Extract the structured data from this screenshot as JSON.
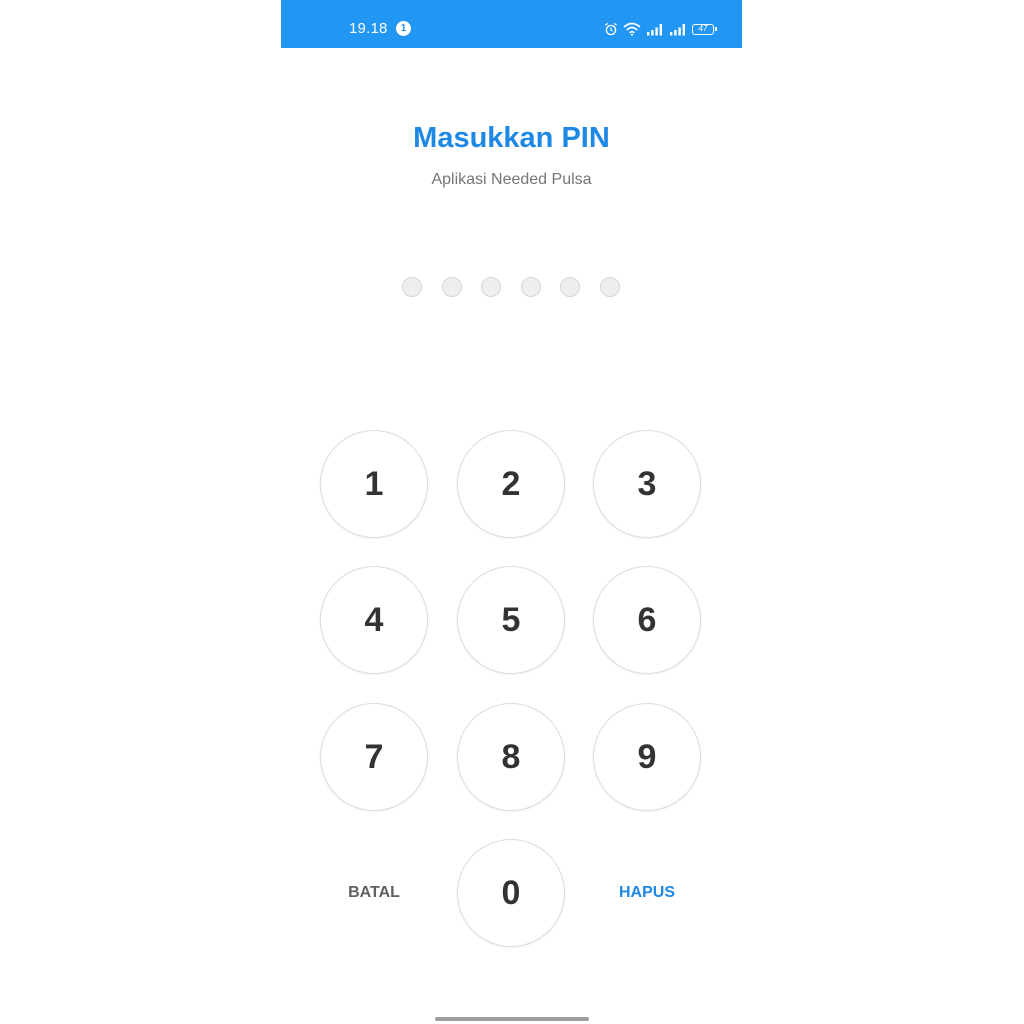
{
  "status_bar": {
    "time": "19.18",
    "notification_count": "1",
    "battery_level": "47",
    "icons": [
      "alarm-icon",
      "wifi-icon",
      "signal-icon",
      "signal-icon",
      "battery-icon"
    ],
    "background_color": "#2196f3"
  },
  "header": {
    "title": "Masukkan PIN",
    "subtitle": "Aplikasi Needed Pulsa",
    "title_color": "#1e88e5"
  },
  "pin": {
    "length": 6,
    "filled": 0
  },
  "keypad": {
    "digits": [
      "1",
      "2",
      "3",
      "4",
      "5",
      "6",
      "7",
      "8",
      "9"
    ],
    "zero": "0",
    "cancel_label": "BATAL",
    "delete_label": "HAPUS",
    "cancel_color": "#616161",
    "delete_color": "#1e88e5"
  }
}
